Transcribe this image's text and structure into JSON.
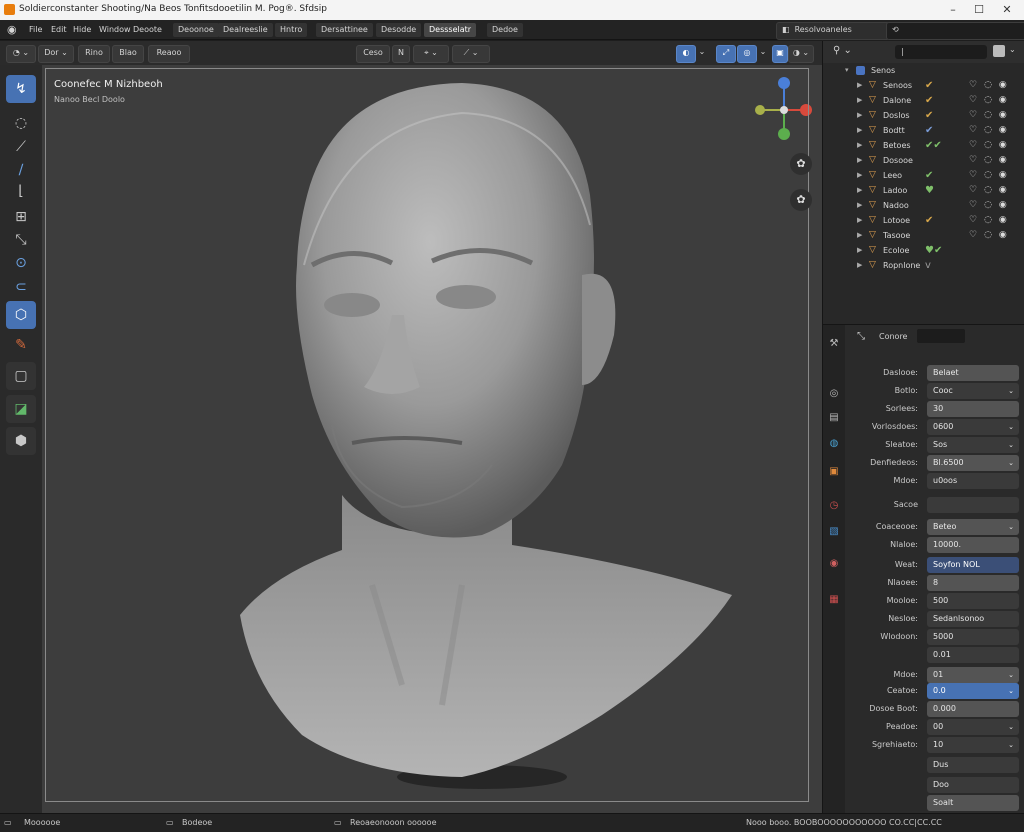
{
  "window": {
    "title": "Soldierconstanter Shooting/Na Beos Tonfitsdooetilin M. Pog®. Sfdsip",
    "controls": [
      "–",
      "☐",
      "✕"
    ]
  },
  "menubar": {
    "logo_icon": "blender-icon",
    "menus": [
      "File",
      "Edit",
      "Hide",
      "Window",
      "Deoote"
    ],
    "tabs": [
      "Deoonoe",
      "Dealreeslie",
      "Hntro",
      "Dersattinee",
      "Desodde",
      "Dessselatr",
      "Dedoe"
    ],
    "active_tab": "Dessselatr",
    "scene_label": "Resolvoaneles",
    "search_placeholder": ""
  },
  "viewport_header": {
    "mode_label": "Dor",
    "view_label": "Rino",
    "select_label": "Blao",
    "add_label": "Reaoo",
    "transform_label": "Ceso",
    "overlay_value": "N"
  },
  "viewport": {
    "title": "Coonefec M Nizhbeoh",
    "subtitle": "Nanoo Becl   Doolo"
  },
  "toolbar": {
    "tools": [
      "draw-brush-icon",
      "clay-icon",
      "crease-icon",
      "smooth-icon",
      "layer-icon",
      "inflate-icon",
      "blob-icon",
      "grab-icon",
      "snake-hook-icon",
      "thumb-icon",
      "pinch-icon",
      "mask-icon",
      "box-mask-icon",
      "transform-icon"
    ]
  },
  "outliner": {
    "header_label": "|",
    "root": "Senos",
    "rows": [
      {
        "name": "Senoos",
        "mod": "✔",
        "mod_color": "#d6a64a"
      },
      {
        "name": "Dalone",
        "mod": "✔",
        "mod_color": "#d6a64a"
      },
      {
        "name": "Doslos",
        "mod": "✔",
        "mod_color": "#d6a64a"
      },
      {
        "name": "Bodtt",
        "mod": "✔",
        "mod_color": "#7a9bd6"
      },
      {
        "name": "Betoes",
        "mod": "✔✔",
        "mod_color": "#7fc06a"
      },
      {
        "name": "Dosooe",
        "mod": "",
        "mod_color": "#d6a64a"
      },
      {
        "name": "Leeo",
        "mod": "✔",
        "mod_color": "#7fc06a"
      },
      {
        "name": "Ladoo",
        "mod": "♥",
        "mod_color": "#7fc06a"
      },
      {
        "name": "Nadoo",
        "mod": "",
        "mod_color": "#d6a64a"
      },
      {
        "name": "Lotooe",
        "mod": "✔",
        "mod_color": "#d6a64a"
      },
      {
        "name": "Tasooe",
        "mod": "",
        "mod_color": "#d6a64a"
      },
      {
        "name": "Ecoloe",
        "mod": "♥✔",
        "mod_color": "#7fc06a"
      },
      {
        "name": "Ropnlone",
        "mod": "v",
        "mod_color": "#999999"
      }
    ]
  },
  "properties": {
    "header": "Conore",
    "fields": [
      {
        "label": "Daslooe:",
        "value": "Belaet",
        "style": "normal",
        "chev": ""
      },
      {
        "label": "Botlo:",
        "value": "Cooc",
        "style": "dark",
        "chev": "⌄"
      },
      {
        "label": "Sorlees:",
        "value": "30",
        "style": "normal",
        "chev": ""
      },
      {
        "label": "Vorlosdoes:",
        "value": "0600",
        "style": "dark",
        "chev": "⌄"
      },
      {
        "label": "Sleatoe:",
        "value": "Sos",
        "style": "dark",
        "chev": "⌄"
      },
      {
        "label": "Denfiedeos:",
        "value": "Bl.6500",
        "style": "normal",
        "chev": "⌄"
      },
      {
        "label": "Mdoe:",
        "value": "u0oos",
        "style": "dark",
        "chev": ""
      },
      {
        "label": "Sacoe",
        "value": "",
        "style": "dark",
        "chev": ""
      },
      {
        "label": "Coaceooe:",
        "value": "Beteo",
        "style": "normal",
        "chev": "⌄"
      },
      {
        "label": "Nlaloe:",
        "value": "10000.",
        "style": "normal",
        "chev": ""
      },
      {
        "label": "Weat:",
        "value": "Soyfon NOL",
        "style": "navy",
        "chev": ""
      },
      {
        "label": "Nlaoee:",
        "value": "8",
        "style": "normal",
        "chev": ""
      },
      {
        "label": "Mooloe:",
        "value": "500",
        "style": "dark",
        "chev": ""
      },
      {
        "label": "Nesloe:",
        "value": "Sedanlsonoo",
        "style": "dark",
        "chev": ""
      },
      {
        "label": "Wlodoon:",
        "value": "5000",
        "style": "dark",
        "chev": ""
      },
      {
        "label": "",
        "value": "0.01",
        "style": "dark",
        "chev": ""
      },
      {
        "label": "Mdoe:",
        "value": "01",
        "style": "normal",
        "chev": "⌄"
      },
      {
        "label": "Ceatoe:",
        "value": "0.0",
        "style": "blue",
        "chev": "⌄"
      },
      {
        "label": "Dosoe Boot:",
        "value": "0.000",
        "style": "normal",
        "chev": ""
      },
      {
        "label": "Peadoe:",
        "value": "00",
        "style": "dark",
        "chev": "⌄"
      },
      {
        "label": "Sgrehiaeto:",
        "value": "10",
        "style": "dark",
        "chev": "⌄"
      },
      {
        "label": "",
        "value": "Dus",
        "style": "dark",
        "chev": ""
      },
      {
        "label": "",
        "value": "Doo",
        "style": "dark",
        "chev": ""
      },
      {
        "label": "",
        "value": "Soalt",
        "style": "normal",
        "chev": ""
      }
    ]
  },
  "statusbar": {
    "left": "Moooooe",
    "mid1": "Bodeoe",
    "mid2": "Reoaeonooon oooooe",
    "right": "Nooo booo. BOOBOOOOOOOOOOO CO.CC|CC.CC"
  }
}
